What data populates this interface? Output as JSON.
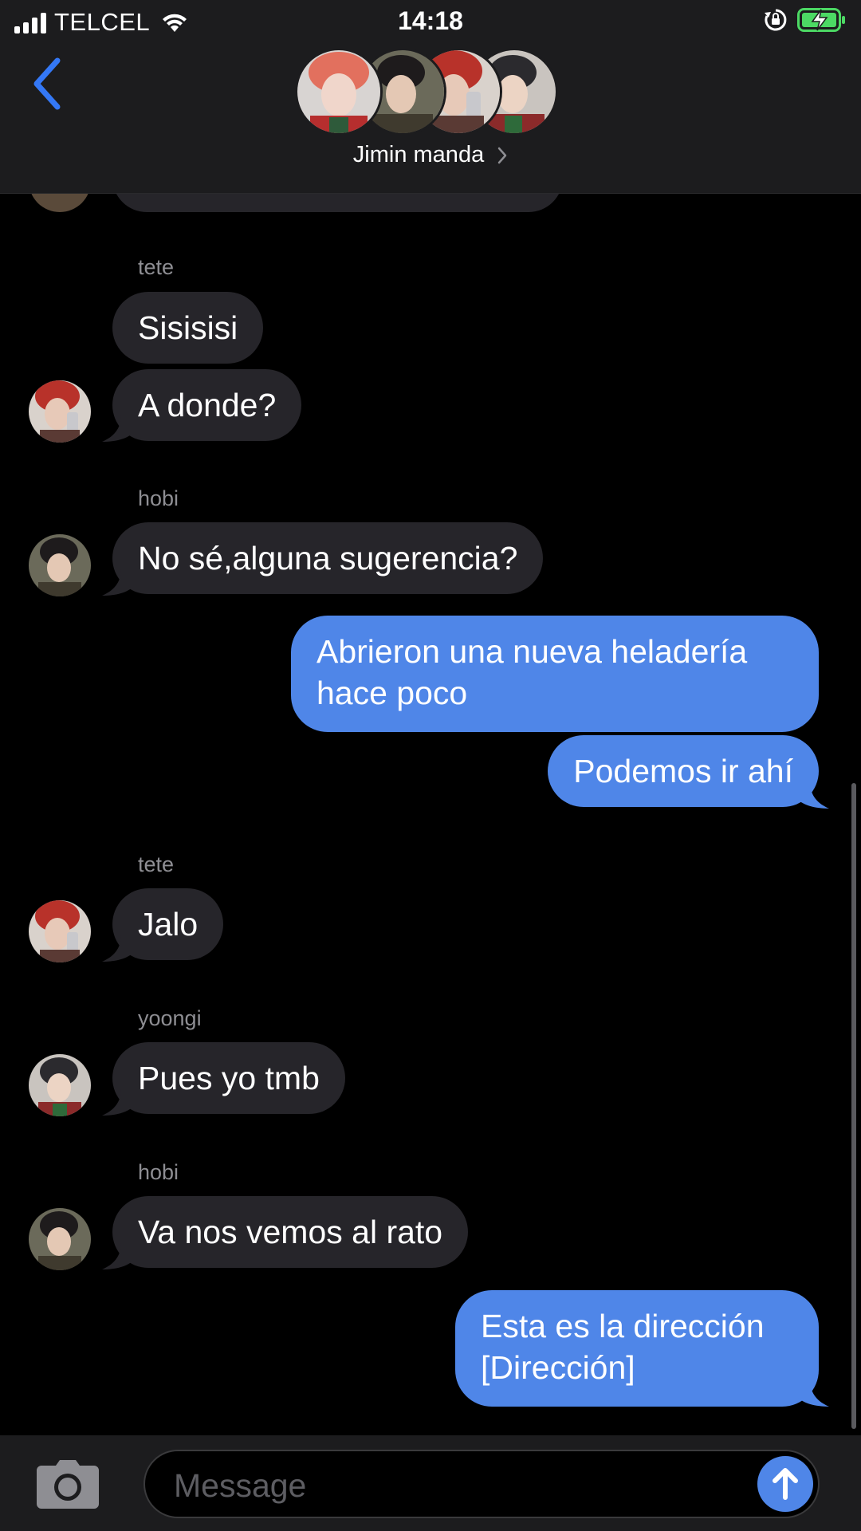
{
  "status_bar": {
    "carrier": "TELCEL",
    "time": "14:18",
    "battery_state": "charging",
    "battery_color": "#4cd964"
  },
  "header": {
    "back_icon": "chevron-left-icon",
    "group_name": "Jimin manda",
    "accent": "#3478f6",
    "participants": [
      "member-1",
      "member-2",
      "member-3",
      "member-4"
    ]
  },
  "messages": [
    {
      "id": "m0",
      "direction": "in",
      "sender": "",
      "text": ""
    },
    {
      "id": "m1",
      "direction": "in",
      "sender": "tete",
      "text": "Sisisisi"
    },
    {
      "id": "m2",
      "direction": "in",
      "sender": "",
      "text": "A donde?"
    },
    {
      "id": "m3",
      "direction": "in",
      "sender": "hobi",
      "text": "No sé,alguna sugerencia?"
    },
    {
      "id": "m4",
      "direction": "out",
      "sender": "",
      "text": "Abrieron una nueva heladería\nhace poco"
    },
    {
      "id": "m5",
      "direction": "out",
      "sender": "",
      "text": "Podemos ir ahí"
    },
    {
      "id": "m6",
      "direction": "in",
      "sender": "tete",
      "text": "Jalo"
    },
    {
      "id": "m7",
      "direction": "in",
      "sender": "yoongi",
      "text": "Pues yo tmb"
    },
    {
      "id": "m8",
      "direction": "in",
      "sender": "hobi",
      "text": "Va nos vemos al rato"
    },
    {
      "id": "m9",
      "direction": "out",
      "sender": "",
      "text": "Esta es la dirección\n[Dirección]"
    }
  ],
  "composer": {
    "placeholder": "Message",
    "camera_icon": "camera-icon",
    "send_icon": "arrow-up-icon"
  },
  "colors": {
    "incoming_bubble": "#26252a",
    "outgoing_bubble": "#4f86e8",
    "background": "#000000"
  }
}
